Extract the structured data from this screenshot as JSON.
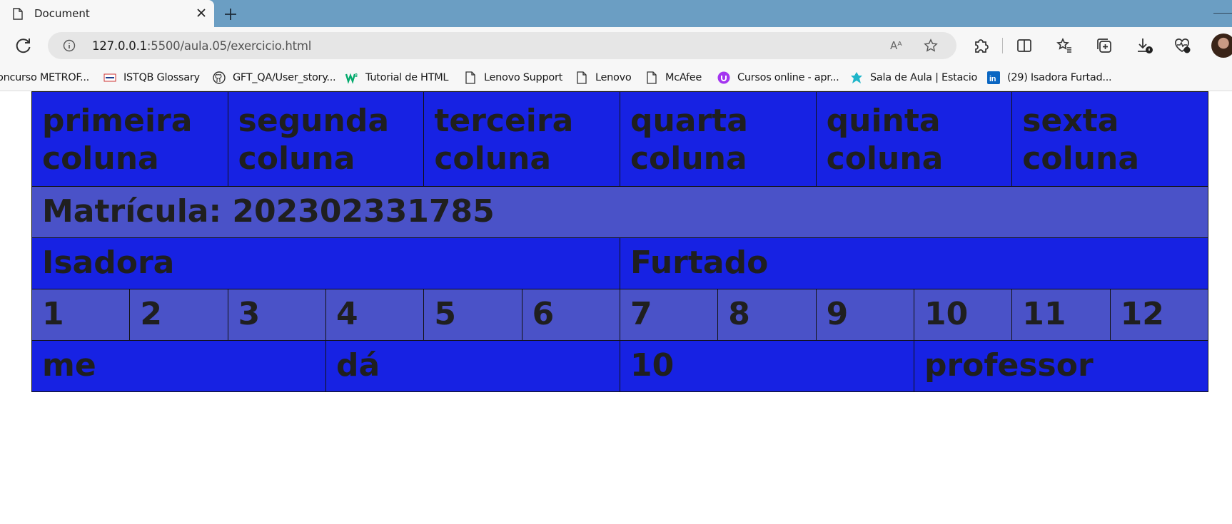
{
  "browser": {
    "tab_title": "Document",
    "address": {
      "host": "127.0.0.1",
      "path": ":5500/aula.05/exercicio.html"
    },
    "read_aloud_glyph": "Aᴬ",
    "bookmarks": [
      {
        "label": "oncurso METROF...",
        "icon": "none"
      },
      {
        "label": "ISTQB Glossary",
        "icon": "istqb-icon"
      },
      {
        "label": "GFT_QA/User_story...",
        "icon": "github-icon"
      },
      {
        "label": "Tutorial de HTML",
        "icon": "w3schools-icon"
      },
      {
        "label": "Lenovo Support",
        "icon": "page-icon"
      },
      {
        "label": "Lenovo",
        "icon": "page-icon"
      },
      {
        "label": "McAfee",
        "icon": "page-icon"
      },
      {
        "label": "Cursos online - apr...",
        "icon": "udemy-icon"
      },
      {
        "label": "Sala de Aula | Estacio",
        "icon": "estacio-icon"
      },
      {
        "label": "(29) Isadora Furtad...",
        "icon": "linkedin-icon"
      }
    ]
  },
  "table": {
    "header": [
      "primeira coluna",
      "segunda coluna",
      "terceira coluna",
      "quarta coluna",
      "quinta coluna",
      "sexta coluna"
    ],
    "matricula": "Matrícula: 202302331785",
    "name": {
      "first": "Isadora",
      "last": "Furtado"
    },
    "numbers": [
      "1",
      "2",
      "3",
      "4",
      "5",
      "6",
      "7",
      "8",
      "9",
      "10",
      "11",
      "12"
    ],
    "phrase": [
      "me",
      "dá",
      "10",
      "professor"
    ]
  },
  "colors": {
    "cell_blue": "#1722e3",
    "cell_slate": "#4a52c8",
    "tabbar": "#6b9ec3"
  }
}
